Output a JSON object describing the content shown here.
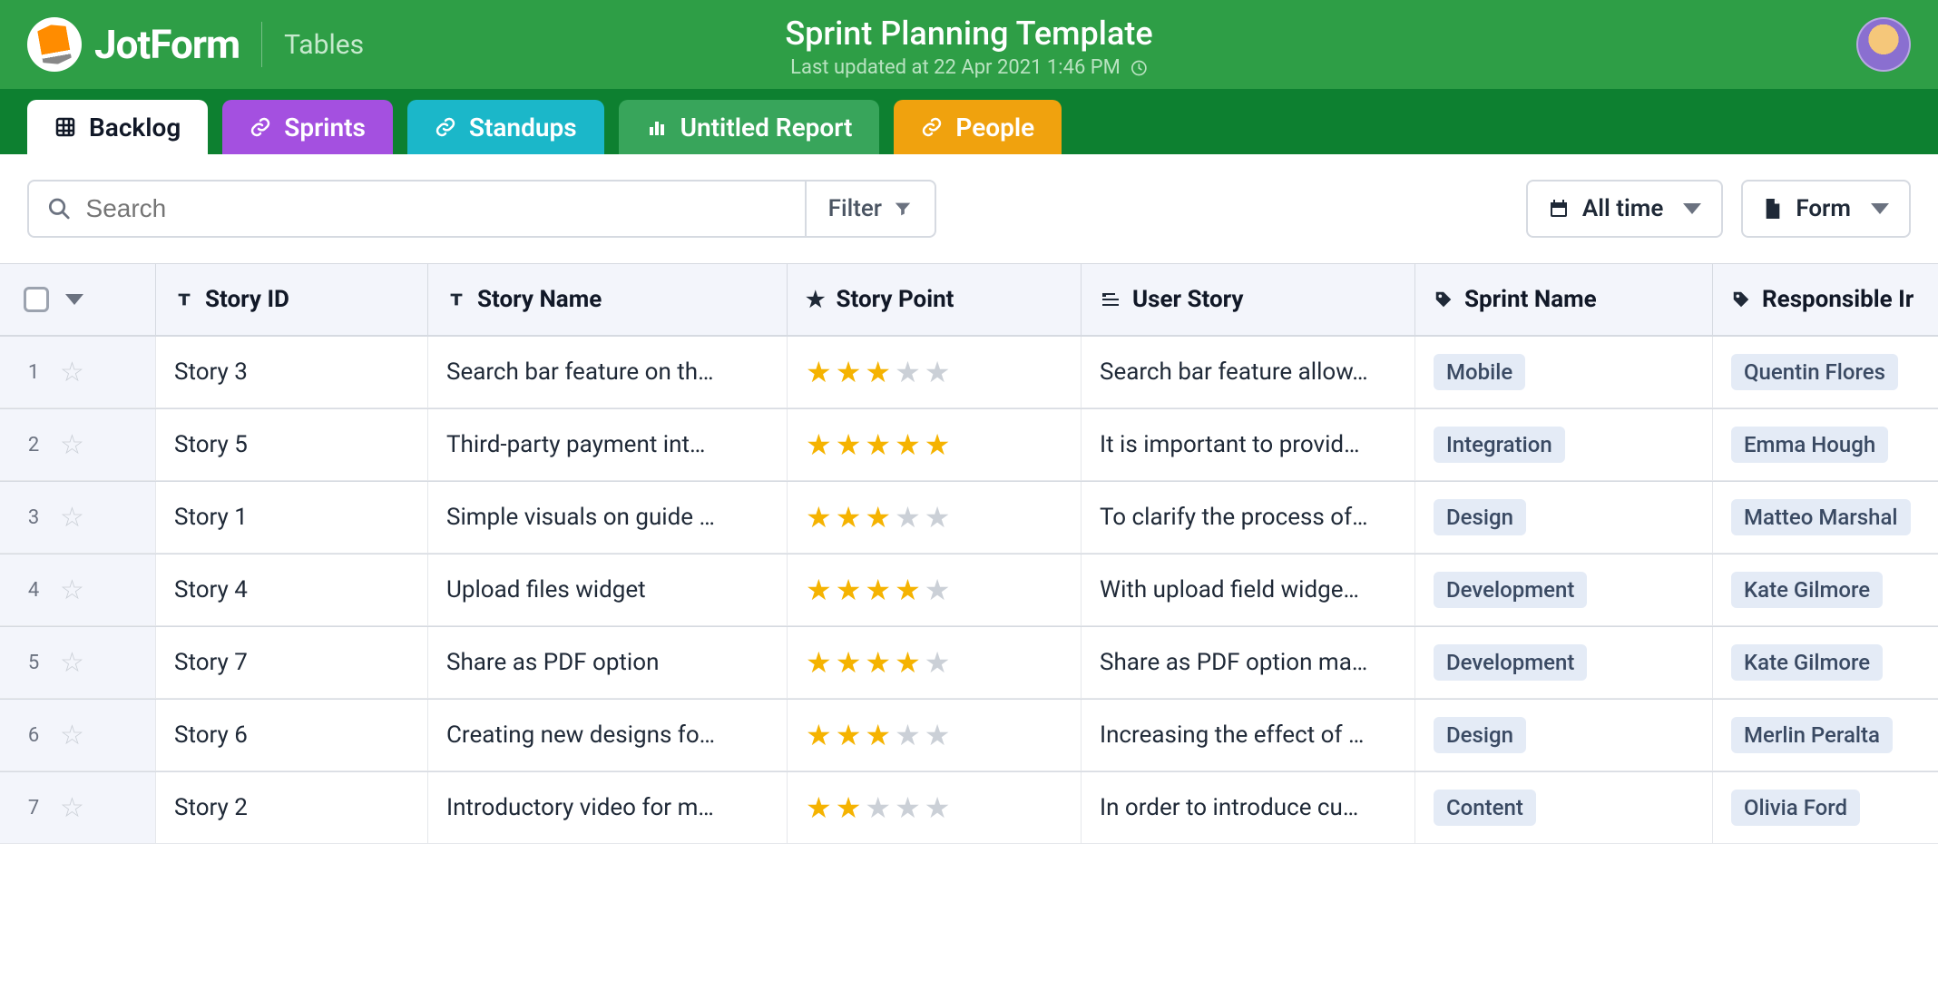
{
  "header": {
    "logo_text": "JotForm",
    "section_label": "Tables",
    "title": "Sprint Planning Template",
    "last_updated": "Last updated at 22 Apr 2021 1:46 PM"
  },
  "tabs": [
    {
      "id": "backlog",
      "label": "Backlog",
      "style": "active",
      "icon": "grid"
    },
    {
      "id": "sprints",
      "label": "Sprints",
      "style": "purple",
      "icon": "link"
    },
    {
      "id": "standups",
      "label": "Standups",
      "style": "teal",
      "icon": "link"
    },
    {
      "id": "report",
      "label": "Untitled Report",
      "style": "green",
      "icon": "chart"
    },
    {
      "id": "people",
      "label": "People",
      "style": "orange",
      "icon": "link"
    }
  ],
  "toolbar": {
    "search_placeholder": "Search",
    "filter_label": "Filter",
    "time_filter": "All time",
    "form_button": "Form"
  },
  "columns": [
    {
      "key": "rownum",
      "label": "",
      "icon": ""
    },
    {
      "key": "story_id",
      "label": "Story ID",
      "icon": "text"
    },
    {
      "key": "story_name",
      "label": "Story Name",
      "icon": "text"
    },
    {
      "key": "story_point",
      "label": "Story Point",
      "icon": "star"
    },
    {
      "key": "user_story",
      "label": "User Story",
      "icon": "longtext"
    },
    {
      "key": "sprint_name",
      "label": "Sprint Name",
      "icon": "tag"
    },
    {
      "key": "responsible",
      "label": "Responsible Ir",
      "icon": "tag"
    }
  ],
  "rows": [
    {
      "n": "1",
      "story_id": "Story 3",
      "story_name": "Search bar feature on th…",
      "story_point": 3,
      "user_story": "Search bar feature allow…",
      "sprint_name": "Mobile",
      "responsible": "Quentin Flores"
    },
    {
      "n": "2",
      "story_id": "Story 5",
      "story_name": "Third-party payment int…",
      "story_point": 5,
      "user_story": "It is important to provid…",
      "sprint_name": "Integration",
      "responsible": "Emma Hough"
    },
    {
      "n": "3",
      "story_id": "Story 1",
      "story_name": "Simple visuals on guide …",
      "story_point": 3,
      "user_story": "To clarify the process of…",
      "sprint_name": "Design",
      "responsible": "Matteo Marshal"
    },
    {
      "n": "4",
      "story_id": "Story 4",
      "story_name": "Upload files widget",
      "story_point": 4,
      "user_story": "With upload field widge…",
      "sprint_name": "Development",
      "responsible": "Kate Gilmore"
    },
    {
      "n": "5",
      "story_id": "Story 7",
      "story_name": "Share as PDF option",
      "story_point": 4,
      "user_story": "Share as PDF option ma…",
      "sprint_name": "Development",
      "responsible": "Kate Gilmore"
    },
    {
      "n": "6",
      "story_id": "Story 6",
      "story_name": "Creating new designs fo…",
      "story_point": 3,
      "user_story": "Increasing the effect of …",
      "sprint_name": "Design",
      "responsible": "Merlin Peralta"
    },
    {
      "n": "7",
      "story_id": "Story 2",
      "story_name": "Introductory video for m…",
      "story_point": 2,
      "user_story": "In order to introduce cu…",
      "sprint_name": "Content",
      "responsible": "Olivia Ford"
    }
  ]
}
